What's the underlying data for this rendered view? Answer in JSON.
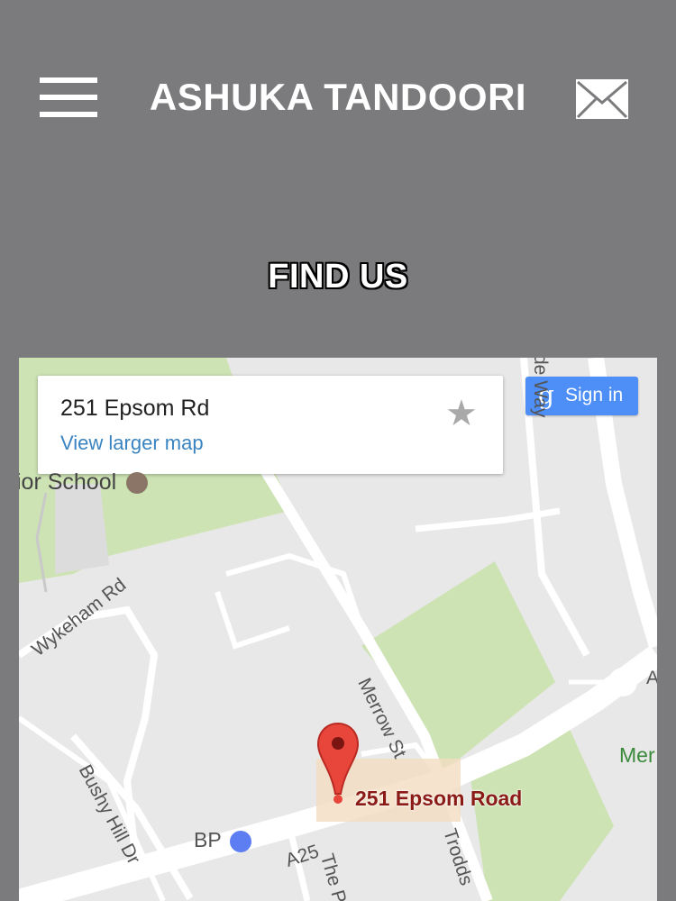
{
  "header": {
    "title": "ASHUKA TANDOORI"
  },
  "icons": {
    "menu": "hamburger-menu-icon",
    "mail": "envelope-icon",
    "star": "star-icon",
    "pin": "map-pin-icon"
  },
  "section": {
    "title": "FIND US"
  },
  "map": {
    "place_card": {
      "name": "251 Epsom Rd",
      "link": "View larger map",
      "star": "★"
    },
    "signin": {
      "g": "g",
      "label": "Sign in"
    },
    "labels": {
      "school": "ior School",
      "wykeham": "Wykeham Rd",
      "merrow": "Merrow St",
      "bushy": "Bushy Hill Dr",
      "bp": "BP",
      "a25": "A25",
      "the_p": "The P",
      "trodds": "Trodds",
      "way": "de Way",
      "mer": "Mer",
      "a_right": "A"
    },
    "pin_label": "251 Epsom Road"
  },
  "colors": {
    "page_bg": "#7b7a7c",
    "map_bg": "#e8e8e8",
    "park": "#cde3b4",
    "road": "#ffffff",
    "link": "#3a84c1",
    "signin": "#4d8ef7",
    "pin": "#e8463b"
  }
}
